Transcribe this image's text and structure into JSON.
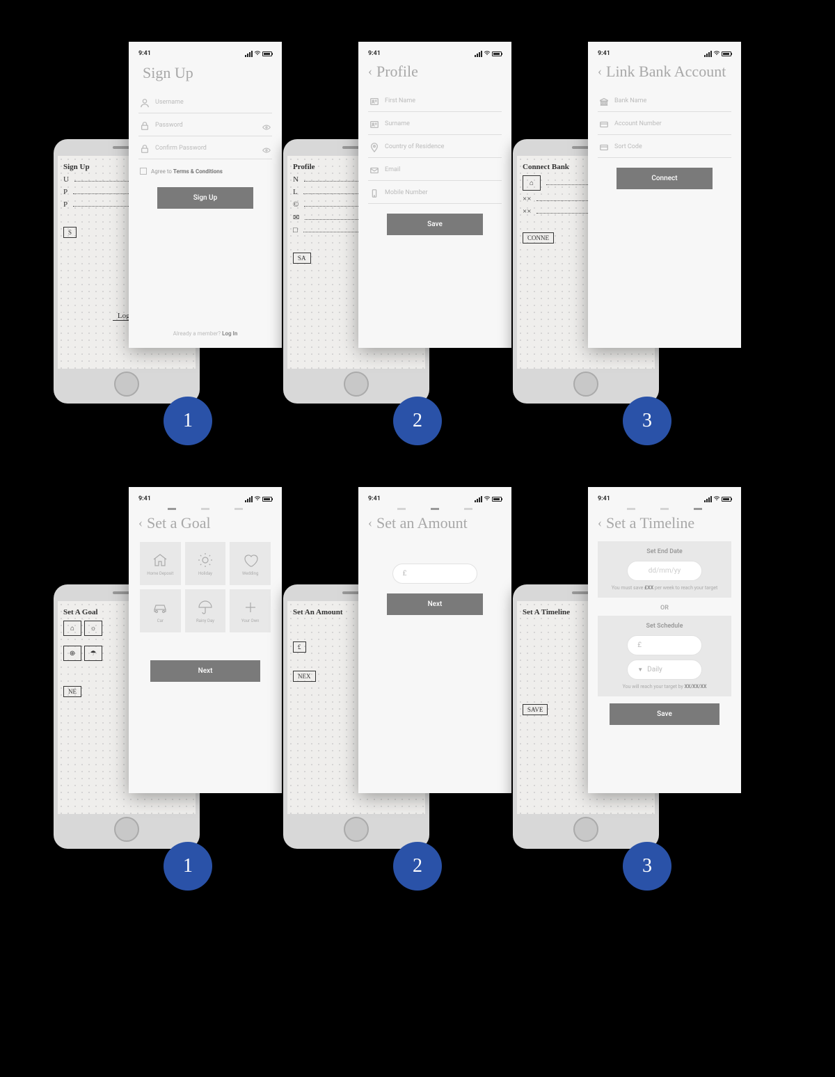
{
  "statusbar": {
    "time": "9:41"
  },
  "badges": [
    "1",
    "2",
    "3",
    "1",
    "2",
    "3"
  ],
  "screens": {
    "signup": {
      "sketch_title": "Sign Up",
      "sketch_rows": [
        "U",
        "P",
        "P"
      ],
      "sketch_btn": "S",
      "sketch_footer": "Login",
      "title": "Sign Up",
      "fields": {
        "username": "Username",
        "password": "Password",
        "confirm": "Confirm Password"
      },
      "terms_prefix": "Agree to ",
      "terms_bold": "Terms & Conditions",
      "button": "Sign Up",
      "footer_prefix": "Already a member? ",
      "footer_link": "Log In"
    },
    "profile": {
      "sketch_title": "Profile",
      "sketch_rows": [
        "N",
        "L",
        "©",
        "✉",
        "□"
      ],
      "sketch_btn": "SA",
      "title": "Profile",
      "fields": {
        "first_name": "First Name",
        "surname": "Surname",
        "country": "Country of Residence",
        "email": "Email",
        "mobile": "Mobile Number"
      },
      "button": "Save"
    },
    "link_bank": {
      "sketch_title": "Connect Bank",
      "sketch_btn": "CONNE",
      "title": "Link Bank Account",
      "fields": {
        "bank": "Bank Name",
        "account": "Account Number",
        "sort": "Sort Code"
      },
      "button": "Connect"
    },
    "set_goal": {
      "sketch_title": "Set A Goal",
      "sketch_btn": "NE",
      "title": "Set a Goal",
      "tiles": {
        "home": "Home Deposit",
        "holiday": "Holiday",
        "wedding": "Wedding",
        "car": "Car",
        "rainy": "Rainy Day",
        "own": "Your Own"
      },
      "button": "Next"
    },
    "set_amount": {
      "sketch_title": "Set An Amount",
      "sketch_prefix": "£",
      "sketch_btn": "NEX",
      "title": "Set an Amount",
      "currency": "£",
      "button": "Next"
    },
    "set_timeline": {
      "sketch_title": "Set A Timeline",
      "sketch_btn": "SAVE",
      "title": "Set a Timeline",
      "date_card_title": "Set End Date",
      "date_placeholder": "dd/mm/yy",
      "date_help_prefix": "You must save ",
      "date_help_bold": "£XX",
      "date_help_suffix": " per week to reach your target",
      "or": "OR",
      "sched_card_title": "Set Schedule",
      "currency": "£",
      "frequency": "Daily",
      "sched_help_prefix": "You will reach your target by ",
      "sched_help_bold": "XX/XX/XX",
      "button": "Save"
    }
  }
}
